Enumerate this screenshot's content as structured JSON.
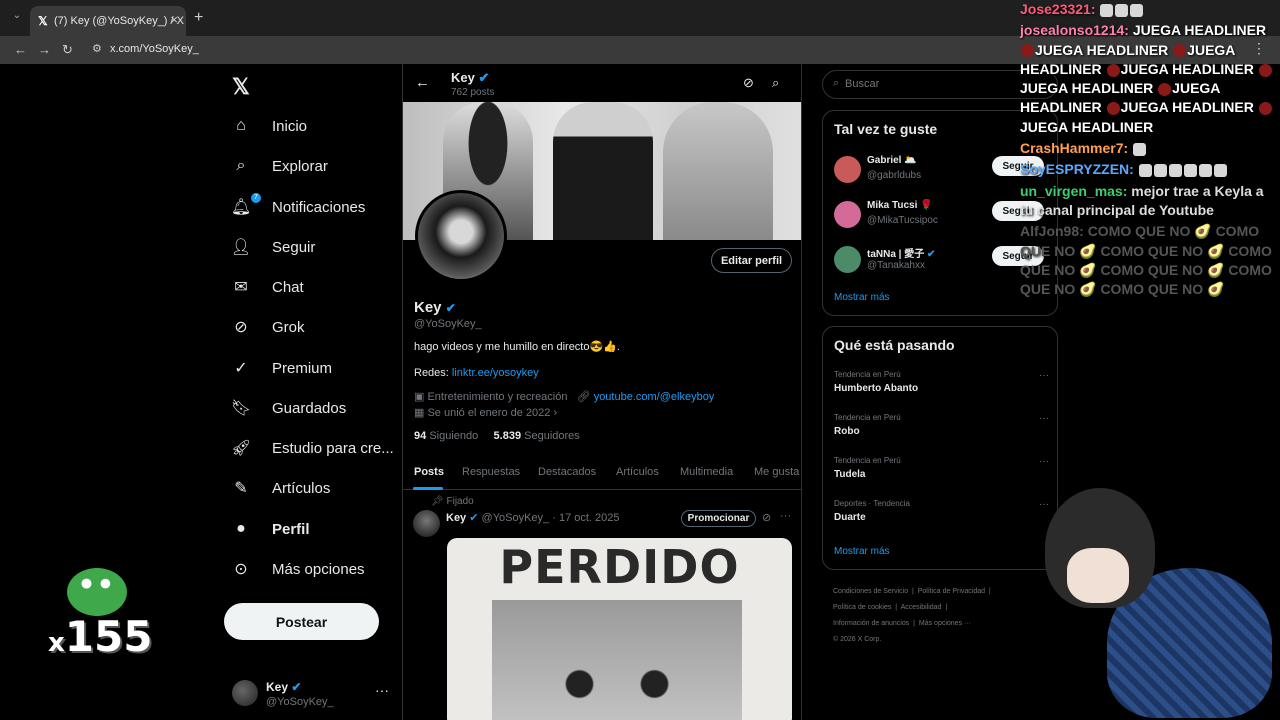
{
  "browser": {
    "tab_title": "(7) Key (@YoSoyKey_) / X",
    "url": "x.com/YoSoyKey_"
  },
  "nav": {
    "items": [
      {
        "label": "Inicio",
        "icon": "home-icon"
      },
      {
        "label": "Explorar",
        "icon": "search-icon"
      },
      {
        "label": "Notificaciones",
        "icon": "bell-icon",
        "badge": "7"
      },
      {
        "label": "Seguir",
        "icon": "add-user-icon"
      },
      {
        "label": "Chat",
        "icon": "mail-icon"
      },
      {
        "label": "Grok",
        "icon": "grok-icon"
      },
      {
        "label": "Premium",
        "icon": "verified-icon"
      },
      {
        "label": "Guardados",
        "icon": "bookmark-icon"
      },
      {
        "label": "Estudio para cre...",
        "icon": "rocket-icon"
      },
      {
        "label": "Artículos",
        "icon": "article-icon"
      },
      {
        "label": "Perfil",
        "icon": "user-icon"
      },
      {
        "label": "Más opciones",
        "icon": "more-circle-icon"
      }
    ],
    "post_button": "Postear",
    "account": {
      "name": "Key",
      "handle": "@YoSoyKey_"
    }
  },
  "profile": {
    "header_name": "Key",
    "header_posts": "762 posts",
    "edit_button": "Editar perfil",
    "name": "Key",
    "handle": "@YoSoyKey_",
    "bio": "hago videos y me humillo en directo😎👍.",
    "redes_label": "Redes: ",
    "redes_link": "linktr.ee/yosoykey",
    "category": "Entretenimiento y recreación",
    "website": "youtube.com/@elkeyboy",
    "joined": "Se unió el enero de 2022",
    "following_count": "94",
    "following_label": "Siguiendo",
    "followers_count": "5.839",
    "followers_label": "Seguidores",
    "tabs": [
      "Posts",
      "Respuestas",
      "Destacados",
      "Artículos",
      "Multimedia",
      "Me gusta"
    ]
  },
  "pinned_post": {
    "pinned_label": "Fijado",
    "author": "Key",
    "handle": "@YoSoyKey_",
    "date": "· 17 oct. 2025",
    "promote": "Promocionar",
    "poster_text": "PERDIDO"
  },
  "right": {
    "search_placeholder": "Buscar",
    "suggest_title": "Tal vez te guste",
    "suggestions": [
      {
        "name": "Gabriel 🌥️",
        "handle": "@gabrldubs",
        "button": "Seguir",
        "color": "#c85a5a"
      },
      {
        "name": "Mika Tucsi 🌹",
        "handle": "@MikaTucsipoc",
        "button": "Seguir",
        "color": "#d46a9a"
      },
      {
        "name": "taNNa | 愛子",
        "handle": "@Tanakahxx",
        "button": "Seguir",
        "color": "#4c8a6a"
      }
    ],
    "show_more": "Mostrar más",
    "trends_title": "Qué está pasando",
    "trends": [
      {
        "context": "Tendencia en Perú",
        "topic": "Humberto Abanto"
      },
      {
        "context": "Tendencia en Perú",
        "topic": "Robo"
      },
      {
        "context": "Tendencia en Perú",
        "topic": "Tudela"
      },
      {
        "context": "Deportes · Tendencia",
        "topic": "Duarte"
      }
    ],
    "footer": {
      "l1a": "Condiciones de Servicio",
      "l1b": "Política de Privacidad",
      "l2a": "Política de cookies",
      "l2b": "Accesibilidad",
      "l3a": "Información de anuncios",
      "l3b": "Más opciones ···",
      "copyright": "© 2026 X Corp."
    }
  },
  "chat": {
    "m1_user": "Jose23321:",
    "m2_user": "josealonso1214:",
    "m2_text": "JUEGA HEADLINER",
    "m3_user": "CrashHammer7:",
    "m4_user": "SoyESPRYZZEN:",
    "m5_user": "un_virgen_mas:",
    "m5_text": "mejor trae a Keyla a tu canal principal de Youtube",
    "m6_user": "AlfJon98:",
    "m6_text": "COMO QUE NO 🥑 COMO QUE NO 🥑 COMO QUE NO 🥑 COMO QUE NO 🥑 COMO QUE NO 🥑 COMO QUE NO 🥑 COMO QUE NO 🥑"
  },
  "overlay": {
    "combo_x": "x",
    "combo_count": "155"
  }
}
